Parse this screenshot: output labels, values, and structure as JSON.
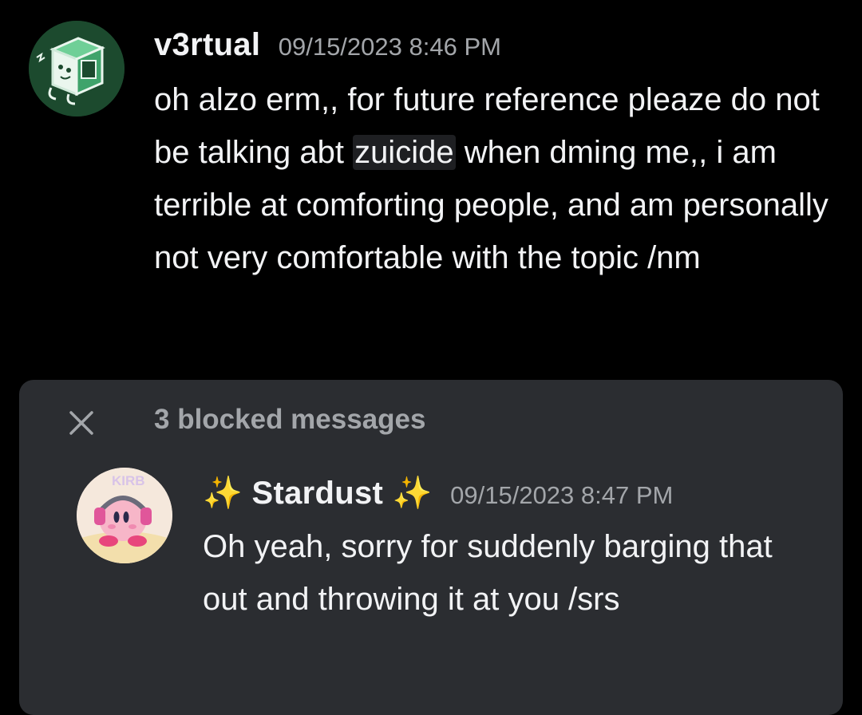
{
  "messages": [
    {
      "username": "v3rtual",
      "timestamp": "09/15/2023 8:46 PM",
      "text_before": "oh alzo erm,, for future reference pleaze do not be talking abt ",
      "spoiler": "zuicide",
      "text_after": " when dming me,, i am terrible at comforting people, and am personally not very comfortable with the topic /nm",
      "avatar_icon": "green-cube-mascot-avatar"
    }
  ],
  "blocked": {
    "label": "3 blocked messages",
    "close_icon": "close-icon",
    "message": {
      "username": "✨ Stardust ✨",
      "timestamp": "09/15/2023 8:47 PM",
      "text": "Oh yeah, sorry for suddenly barging that out and throwing it at you /srs",
      "avatar_icon": "kirby-avatar",
      "avatar_text": "KIRB"
    }
  },
  "colors": {
    "background": "#000000",
    "panel": "#2b2d31",
    "text": "#f2f3f5",
    "muted": "#a3a6aa",
    "spoiler_bg": "#1e1f22"
  }
}
